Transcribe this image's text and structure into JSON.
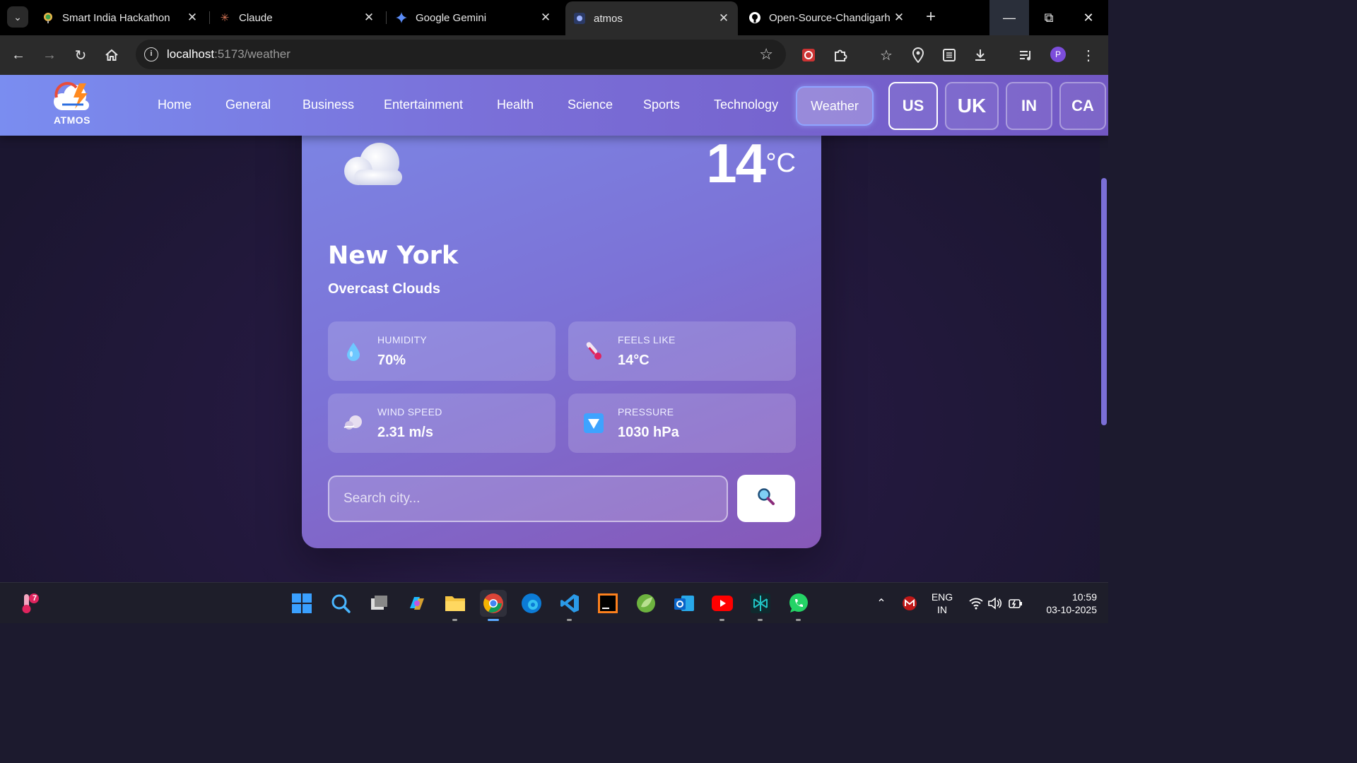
{
  "browser": {
    "tabs": [
      {
        "title": "Smart India Hackathon",
        "icon": "sih-favicon"
      },
      {
        "title": "Claude",
        "icon": "claude-favicon"
      },
      {
        "title": "Google Gemini",
        "icon": "gemini-favicon"
      },
      {
        "title": "atmos",
        "icon": "atmos-favicon",
        "active": true
      },
      {
        "title": "Open-Source-Chandigarh",
        "icon": "github-favicon"
      }
    ],
    "url_host": "localhost",
    "url_path": ":5173/weather",
    "profile_initial": "P"
  },
  "app": {
    "logo_text": "ATMOS",
    "nav": {
      "home": "Home",
      "general": "General",
      "business": "Business",
      "entertainment": "Entertainment",
      "health": "Health",
      "science": "Science",
      "sports": "Sports",
      "technology": "Technology",
      "weather": "Weather"
    },
    "countries": {
      "us": "US",
      "uk": "UK",
      "in": "IN",
      "ca": "CA"
    },
    "active_country": "US"
  },
  "weather": {
    "temperature": "14",
    "unit": "°C",
    "city": "New York",
    "description": "Overcast Clouds",
    "humidity_label": "HUMIDITY",
    "humidity_value": "70%",
    "feels_label": "FEELS LIKE",
    "feels_value": "14°C",
    "wind_label": "WIND SPEED",
    "wind_value": "2.31 m/s",
    "pressure_label": "PRESSURE",
    "pressure_value": "1030 hPa",
    "search_placeholder": "Search city..."
  },
  "taskbar": {
    "weather_badge": "7",
    "lang_top": "ENG",
    "lang_bottom": "IN",
    "time": "10:59",
    "date": "03-10-2025"
  },
  "colors": {
    "nav_start": "#7a8df0",
    "nav_end": "#7258c4",
    "card_start": "#7c88e6",
    "card_end": "#8658b8"
  }
}
